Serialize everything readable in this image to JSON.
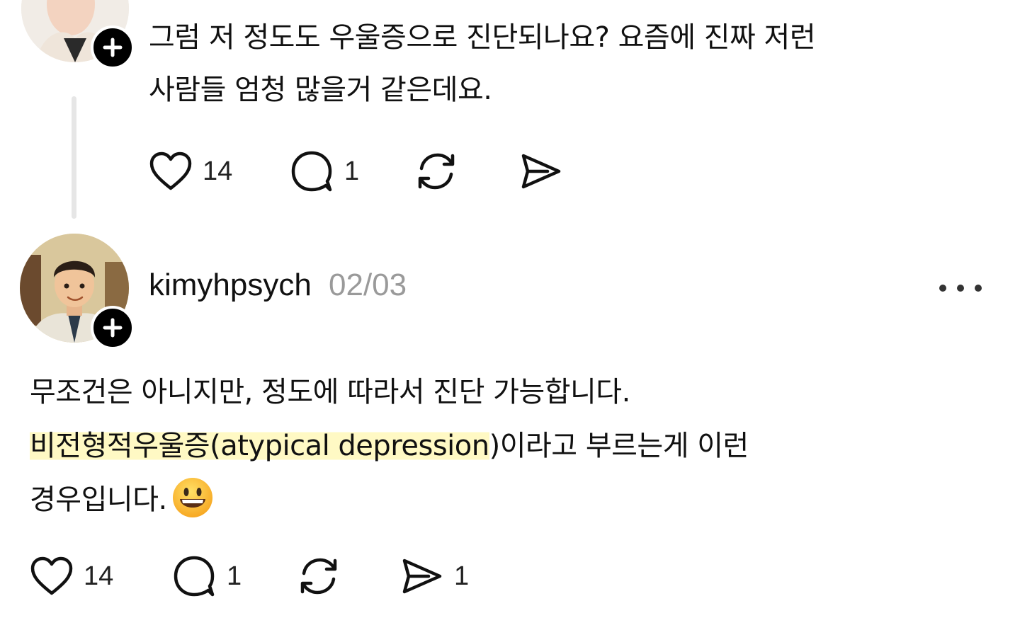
{
  "post1": {
    "text_line1": "그럼 저 정도도 우울증으로 진단되나요? 요즘에 진짜 저런",
    "text_line2": "사람들 엄청 많을거 같은데요.",
    "like_count": "14",
    "reply_count": "1",
    "icons": [
      "heart-icon",
      "comment-icon",
      "repost-icon",
      "send-icon",
      "plus-icon"
    ]
  },
  "post2": {
    "username": "kimyhpsych",
    "date": "02/03",
    "line1": "무조건은 아니지만, 정도에 따라서 진단 가능합니다.",
    "line2_highlight": "비전형적우울증(atypical depression",
    "line2_rest": ")이라고 부르는게 이런",
    "line3": "경우입니다.",
    "like_count": "14",
    "reply_count": "1",
    "share_count": "1",
    "icons": [
      "heart-icon",
      "comment-icon",
      "repost-icon",
      "send-icon",
      "plus-icon",
      "more-icon",
      "grinning-face-emoji"
    ]
  },
  "colors": {
    "highlight": "#fff9c4",
    "muted_text": "#9a9a9a",
    "thread_line": "#e6e6e6"
  }
}
